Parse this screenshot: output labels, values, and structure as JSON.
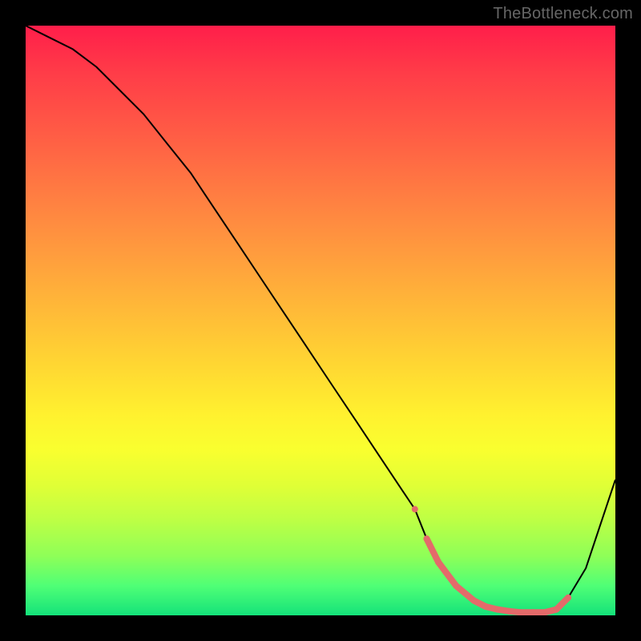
{
  "watermark": "TheBottleneck.com",
  "colors": {
    "background": "#000000",
    "marker": "#e46a6a",
    "curve": "#000000",
    "gradient_top": "#ff1e4a",
    "gradient_bottom": "#14e27a"
  },
  "chart_data": {
    "type": "line",
    "title": "",
    "xlabel": "",
    "ylabel": "",
    "xlim": [
      0,
      100
    ],
    "ylim": [
      0,
      100
    ],
    "grid": false,
    "legend": false,
    "annotations": [
      "TheBottleneck.com"
    ],
    "series": [
      {
        "name": "curve",
        "x": [
          0,
          4,
          8,
          12,
          16,
          20,
          24,
          28,
          32,
          36,
          40,
          44,
          48,
          52,
          56,
          60,
          64,
          66,
          68,
          70,
          73,
          76,
          80,
          84,
          88,
          90,
          92,
          95,
          97,
          100
        ],
        "values": [
          100,
          98,
          96,
          93,
          89,
          85,
          80,
          75,
          69,
          63,
          57,
          51,
          45,
          39,
          33,
          27,
          21,
          18,
          13,
          9,
          5,
          2.5,
          1,
          0.5,
          0.5,
          1,
          3,
          8,
          14,
          23
        ]
      }
    ],
    "markers": {
      "name": "highlight-band",
      "x": [
        68,
        70,
        73,
        76,
        78,
        80,
        82,
        84,
        86,
        88,
        90,
        92
      ],
      "values": [
        13,
        9,
        5,
        2.5,
        1.5,
        1,
        0.7,
        0.5,
        0.5,
        0.5,
        1,
        3
      ]
    }
  }
}
